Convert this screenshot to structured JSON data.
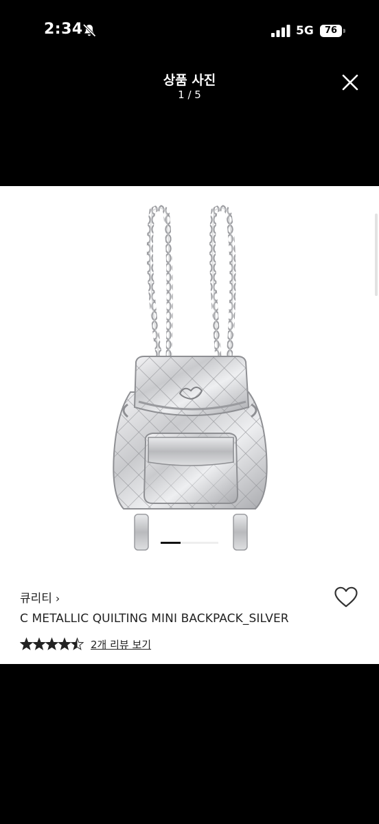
{
  "status_bar": {
    "time": "2:34",
    "network": "5G",
    "battery": "76"
  },
  "header": {
    "title": "상품 사진",
    "counter": "1 / 5"
  },
  "gallery": {
    "current_page": 1,
    "total_pages": 5
  },
  "product": {
    "brand": "큐리티",
    "brand_chevron": "›",
    "name": "C METALLIC QUILTING MINI BACKPACK_SILVER",
    "rating": 4.5,
    "review_link": "2개 리뷰 보기"
  },
  "icons": {
    "mute": "bell-slash-icon",
    "signal": "cellular-signal-icon",
    "battery": "battery-icon",
    "close": "close-icon",
    "favorite": "heart-icon",
    "star": "star-icon"
  },
  "colors": {
    "background": "#000000",
    "panel": "#ffffff",
    "text": "#222222",
    "indicator_active": "#111111"
  }
}
